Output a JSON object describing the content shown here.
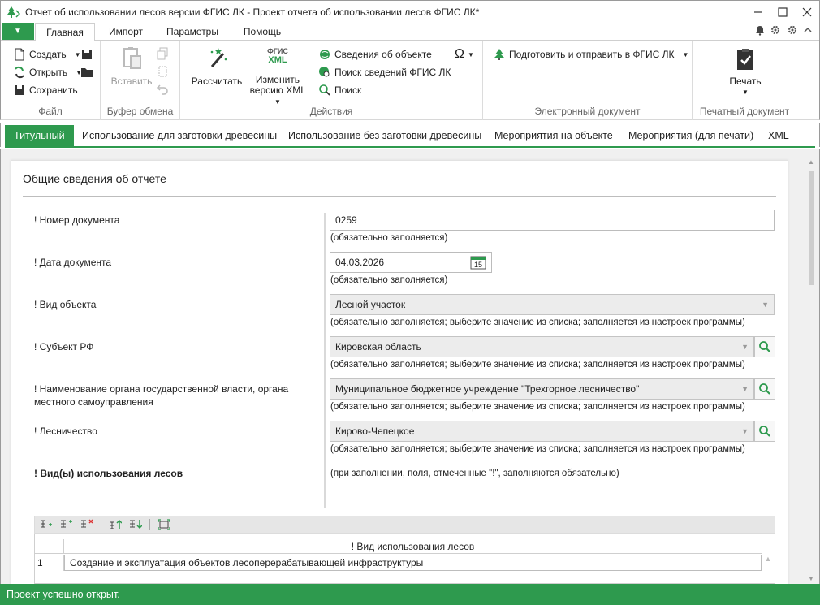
{
  "window": {
    "title": "Отчет об использовании лесов версии ФГИС ЛК - Проект отчета об использовании лесов ФГИС ЛК*"
  },
  "ribbon_tabs": [
    {
      "label": "Главная",
      "active": true
    },
    {
      "label": "Импорт"
    },
    {
      "label": "Параметры"
    },
    {
      "label": "Помощь"
    }
  ],
  "ribbon": {
    "file": {
      "label": "Файл",
      "create": "Создать",
      "open": "Открыть",
      "save": "Сохранить"
    },
    "clipboard": {
      "label": "Буфер обмена",
      "paste": "Вставить"
    },
    "actions": {
      "label": "Действия",
      "calculate": "Рассчитать",
      "change_xml_line1": "Изменить",
      "change_xml_line2": "версию XML",
      "fgis_badge_line1": "ФГИС",
      "fgis_badge_line2": "XML",
      "object_info": "Сведения об объекте",
      "search_fgis": "Поиск сведений ФГИС ЛК",
      "search": "Поиск"
    },
    "edoc": {
      "label": "Электронный документ",
      "prepare_send": "Подготовить и отправить в ФГИС ЛК"
    },
    "print": {
      "label": "Печатный документ",
      "print": "Печать"
    }
  },
  "doc_tabs": [
    {
      "label": "Титульный",
      "active": true
    },
    {
      "label": "Использование для заготовки древесины"
    },
    {
      "label": "Использование без заготовки древесины"
    },
    {
      "label": "Мероприятия на объекте"
    },
    {
      "label": "Мероприятия (для печати)"
    },
    {
      "label": "XML"
    }
  ],
  "form": {
    "title": "Общие сведения об отчете",
    "doc_number": {
      "label": "! Номер документа",
      "value": "0259",
      "hint": "(обязательно заполняется)"
    },
    "doc_date": {
      "label": "! Дата документа",
      "value": "04.03.2026",
      "calendar_day": "15",
      "hint": "(обязательно заполняется)"
    },
    "object_type": {
      "label": "! Вид объекта",
      "value": "Лесной участок",
      "hint": "(обязательно заполняется; выберите значение из списка; заполняется из настроек программы)"
    },
    "subject": {
      "label": "! Субъект РФ",
      "value": "Кировская область",
      "hint": "(обязательно заполняется; выберите значение из списка; заполняется из настроек программы)"
    },
    "authority": {
      "label_line1": "! Наименование органа государственной власти, органа",
      "label_line2": "местного самоуправления",
      "value": "Муниципальное бюджетное учреждение \"Трехгорное лесничество\"",
      "hint": "(обязательно заполняется; выберите значение из списка; заполняется из настроек программы)"
    },
    "forestry": {
      "label": "! Лесничество",
      "value": "Кирово-Чепецкое",
      "hint": "(обязательно заполняется; выберите значение из списка; заполняется из настроек программы)"
    },
    "usage_types": {
      "label": "! Вид(ы) использования лесов",
      "hint": "(при заполнении, поля, отмеченные \"!\", заполняются обязательно)"
    }
  },
  "grid": {
    "column_header": "! Вид использования лесов",
    "rows": [
      {
        "num": "1",
        "value": "Создание и эксплуатация объектов лесоперерабатывающей инфраструктуры"
      }
    ]
  },
  "status": {
    "text": "Проект успешно открыт."
  },
  "colors": {
    "accent": "#2e9a4e"
  }
}
